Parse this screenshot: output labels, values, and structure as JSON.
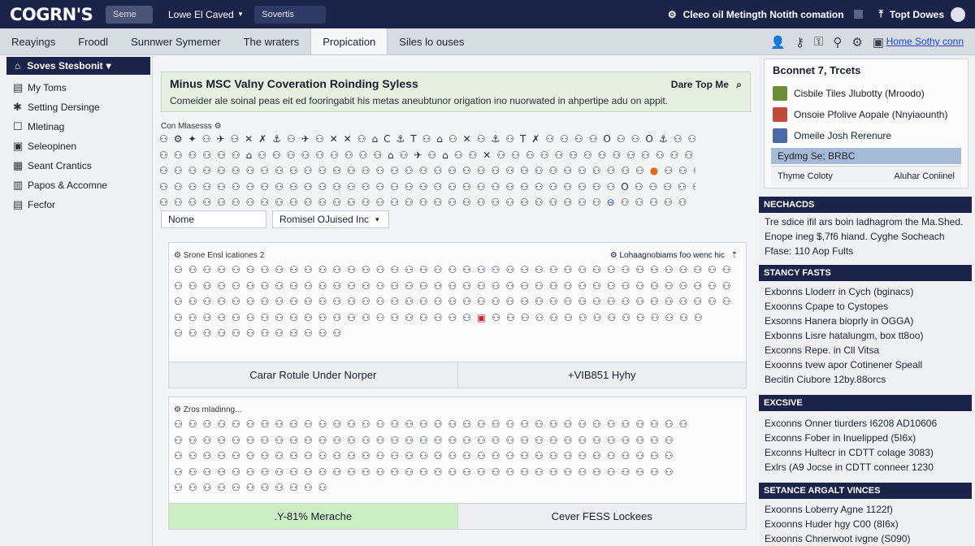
{
  "topbar": {
    "logo": "COGRN'S",
    "search_label": "Seme",
    "location_label": "Lowe El Caved",
    "location_caret": "▾",
    "select_label": "Sovertis",
    "notifications_label": "Cleeo oil Metingth Notith comation",
    "account_label": "Topt Dowes",
    "colors": {
      "bar": "#1b2448",
      "accent": "#4a5478"
    }
  },
  "nav": {
    "tabs": [
      {
        "label": "Reayings"
      },
      {
        "label": "Froodl"
      },
      {
        "label": "Sunnwer Symemer"
      },
      {
        "label": "The wraters"
      },
      {
        "label": "Propication",
        "active": true
      },
      {
        "label": "Siles lo ouses"
      }
    ],
    "link": "Home Sothy conn",
    "icons": [
      "person-icon",
      "key-icon",
      "key-icon",
      "tree-icon",
      "gear-icon",
      "save-icon"
    ]
  },
  "sidebar": {
    "header": "Soves Stesbonit",
    "header_caret": "▾",
    "items": [
      {
        "label": "My Toms",
        "icon": "folder-icon",
        "glyph": "▤"
      },
      {
        "label": "Setting Dersinge",
        "icon": "gear-icon",
        "glyph": "✱"
      },
      {
        "label": "Mletinag",
        "icon": "window-icon",
        "glyph": "☐"
      },
      {
        "label": "Seleopinen",
        "icon": "chat-icon",
        "glyph": "▣"
      },
      {
        "label": "Seant Crantics",
        "icon": "grid-icon",
        "glyph": "▦"
      },
      {
        "label": "Papos & Accomne",
        "icon": "document-icon",
        "glyph": "▥"
      },
      {
        "label": "Fecfor",
        "icon": "list-icon",
        "glyph": "▤"
      }
    ]
  },
  "main": {
    "banner_title": "Minus MSC Valny Coveration Roinding Syless",
    "banner_aside": "Dare Top Me",
    "banner_text": "Comeider ale soinal peas eit ed fooringabit his metas aneubtunor origation ino nuorwated in ahpertipe adu on appit.",
    "icon_section_label": "Con Mlasesss",
    "name_field": "Nome",
    "sort_field": "Romisel  OJuised Inc",
    "sort_caret": "▾",
    "card1": {
      "label": "Srone Ensl icationes 2",
      "right_label": "Lohaagnobiams foo wenc hic",
      "button_left": "Carar Rotule Under Norper",
      "button_right": "+VIB851 Hyhy"
    },
    "card2": {
      "label": "Zros mladinng...",
      "button_left": ".Y-81% Merache",
      "button_right": "Cever FESS Lockees"
    },
    "colors": {
      "success": "#cdeec4",
      "banner": "#e6efe0"
    }
  },
  "right": {
    "profile_title": "Bconnet 7, Trcets",
    "rows": [
      {
        "label": "Cisbile Tiles Jlubotty (Mroodo)",
        "avatar_color": "#6d8f3a"
      },
      {
        "label": "Onsoie Pfolive Aopale (Nnyiaounth)",
        "avatar_color": "#c24a3a"
      },
      {
        "label": "Omeile Josh Rerenure",
        "avatar_color": "#4d6aa8"
      }
    ],
    "highlight": "Eydmg Se; BRBC",
    "foot_left": "Thyme Coloty",
    "foot_right": "Aluhar Coniinel",
    "sections": [
      {
        "title": "NECHACDS",
        "lines": [
          "Tre sdice ifil ars boin ladhagrom the Ma.Shed.",
          "Enope ineg $,7f6 hiand. Cyghe Socheach",
          "Ffase: 110 Aop Fults"
        ]
      },
      {
        "title": "STANCY FASTS",
        "lines": [
          "Exbonns Lloderr in Cych (bginacs)",
          "Exoonns Cpape to Cystopes",
          "Exsonns Hanera bioprly in OGGA)",
          "Exbonns Lisre hatalungm, box tt8oo)",
          "Exconns Repe. in Cll Vitsa",
          "Exoonns tvew apor Cotinener Speall",
          "Becitin Ciubore 12by.88orcs"
        ]
      },
      {
        "title": "EXCSIVE",
        "lines": [
          "Exconns Onner tiurders I6208 AD10606",
          "Exconns Fober in Inuelipped (5I6x)",
          "Exconns Hultecr in CDTT colage 3083)",
          "Exlrs (A9 Jocse in CDTT conneer 1230"
        ]
      },
      {
        "title": "SETANCE ARGALT VINCES",
        "lines": [
          "Exoonns Loberry Agne 1122f)",
          "Exoonns Huder hgy C00 (8I6x)",
          "Exoonns Chnerwoot ivgne (S090)"
        ]
      }
    ]
  }
}
